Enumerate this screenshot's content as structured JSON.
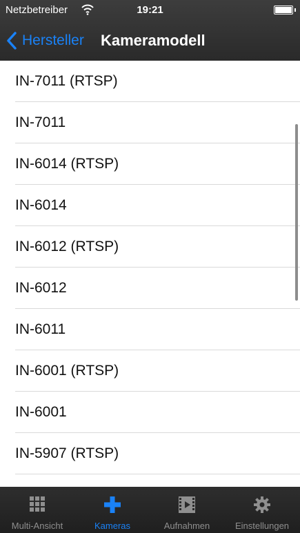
{
  "status_bar": {
    "carrier": "Netzbetreiber",
    "time": "19:21"
  },
  "nav": {
    "back_label": "Hersteller",
    "title": "Kameramodell"
  },
  "models": [
    "IN-7011 (RTSP)",
    "IN-7011",
    "IN-6014 (RTSP)",
    "IN-6014",
    "IN-6012 (RTSP)",
    "IN-6012",
    "IN-6011",
    "IN-6001 (RTSP)",
    "IN-6001",
    "IN-5907 (RTSP)",
    ""
  ],
  "tabs": [
    {
      "label": "Multi-Ansicht",
      "icon": "grid-icon"
    },
    {
      "label": "Kameras",
      "icon": "plus-icon",
      "active": true
    },
    {
      "label": "Aufnahmen",
      "icon": "film-icon"
    },
    {
      "label": "Einstellungen",
      "icon": "gear-icon"
    }
  ],
  "colors": {
    "accent": "#1a82f7",
    "bar_background": "#2e2e2e",
    "inactive_tab": "#8f8f8f"
  }
}
